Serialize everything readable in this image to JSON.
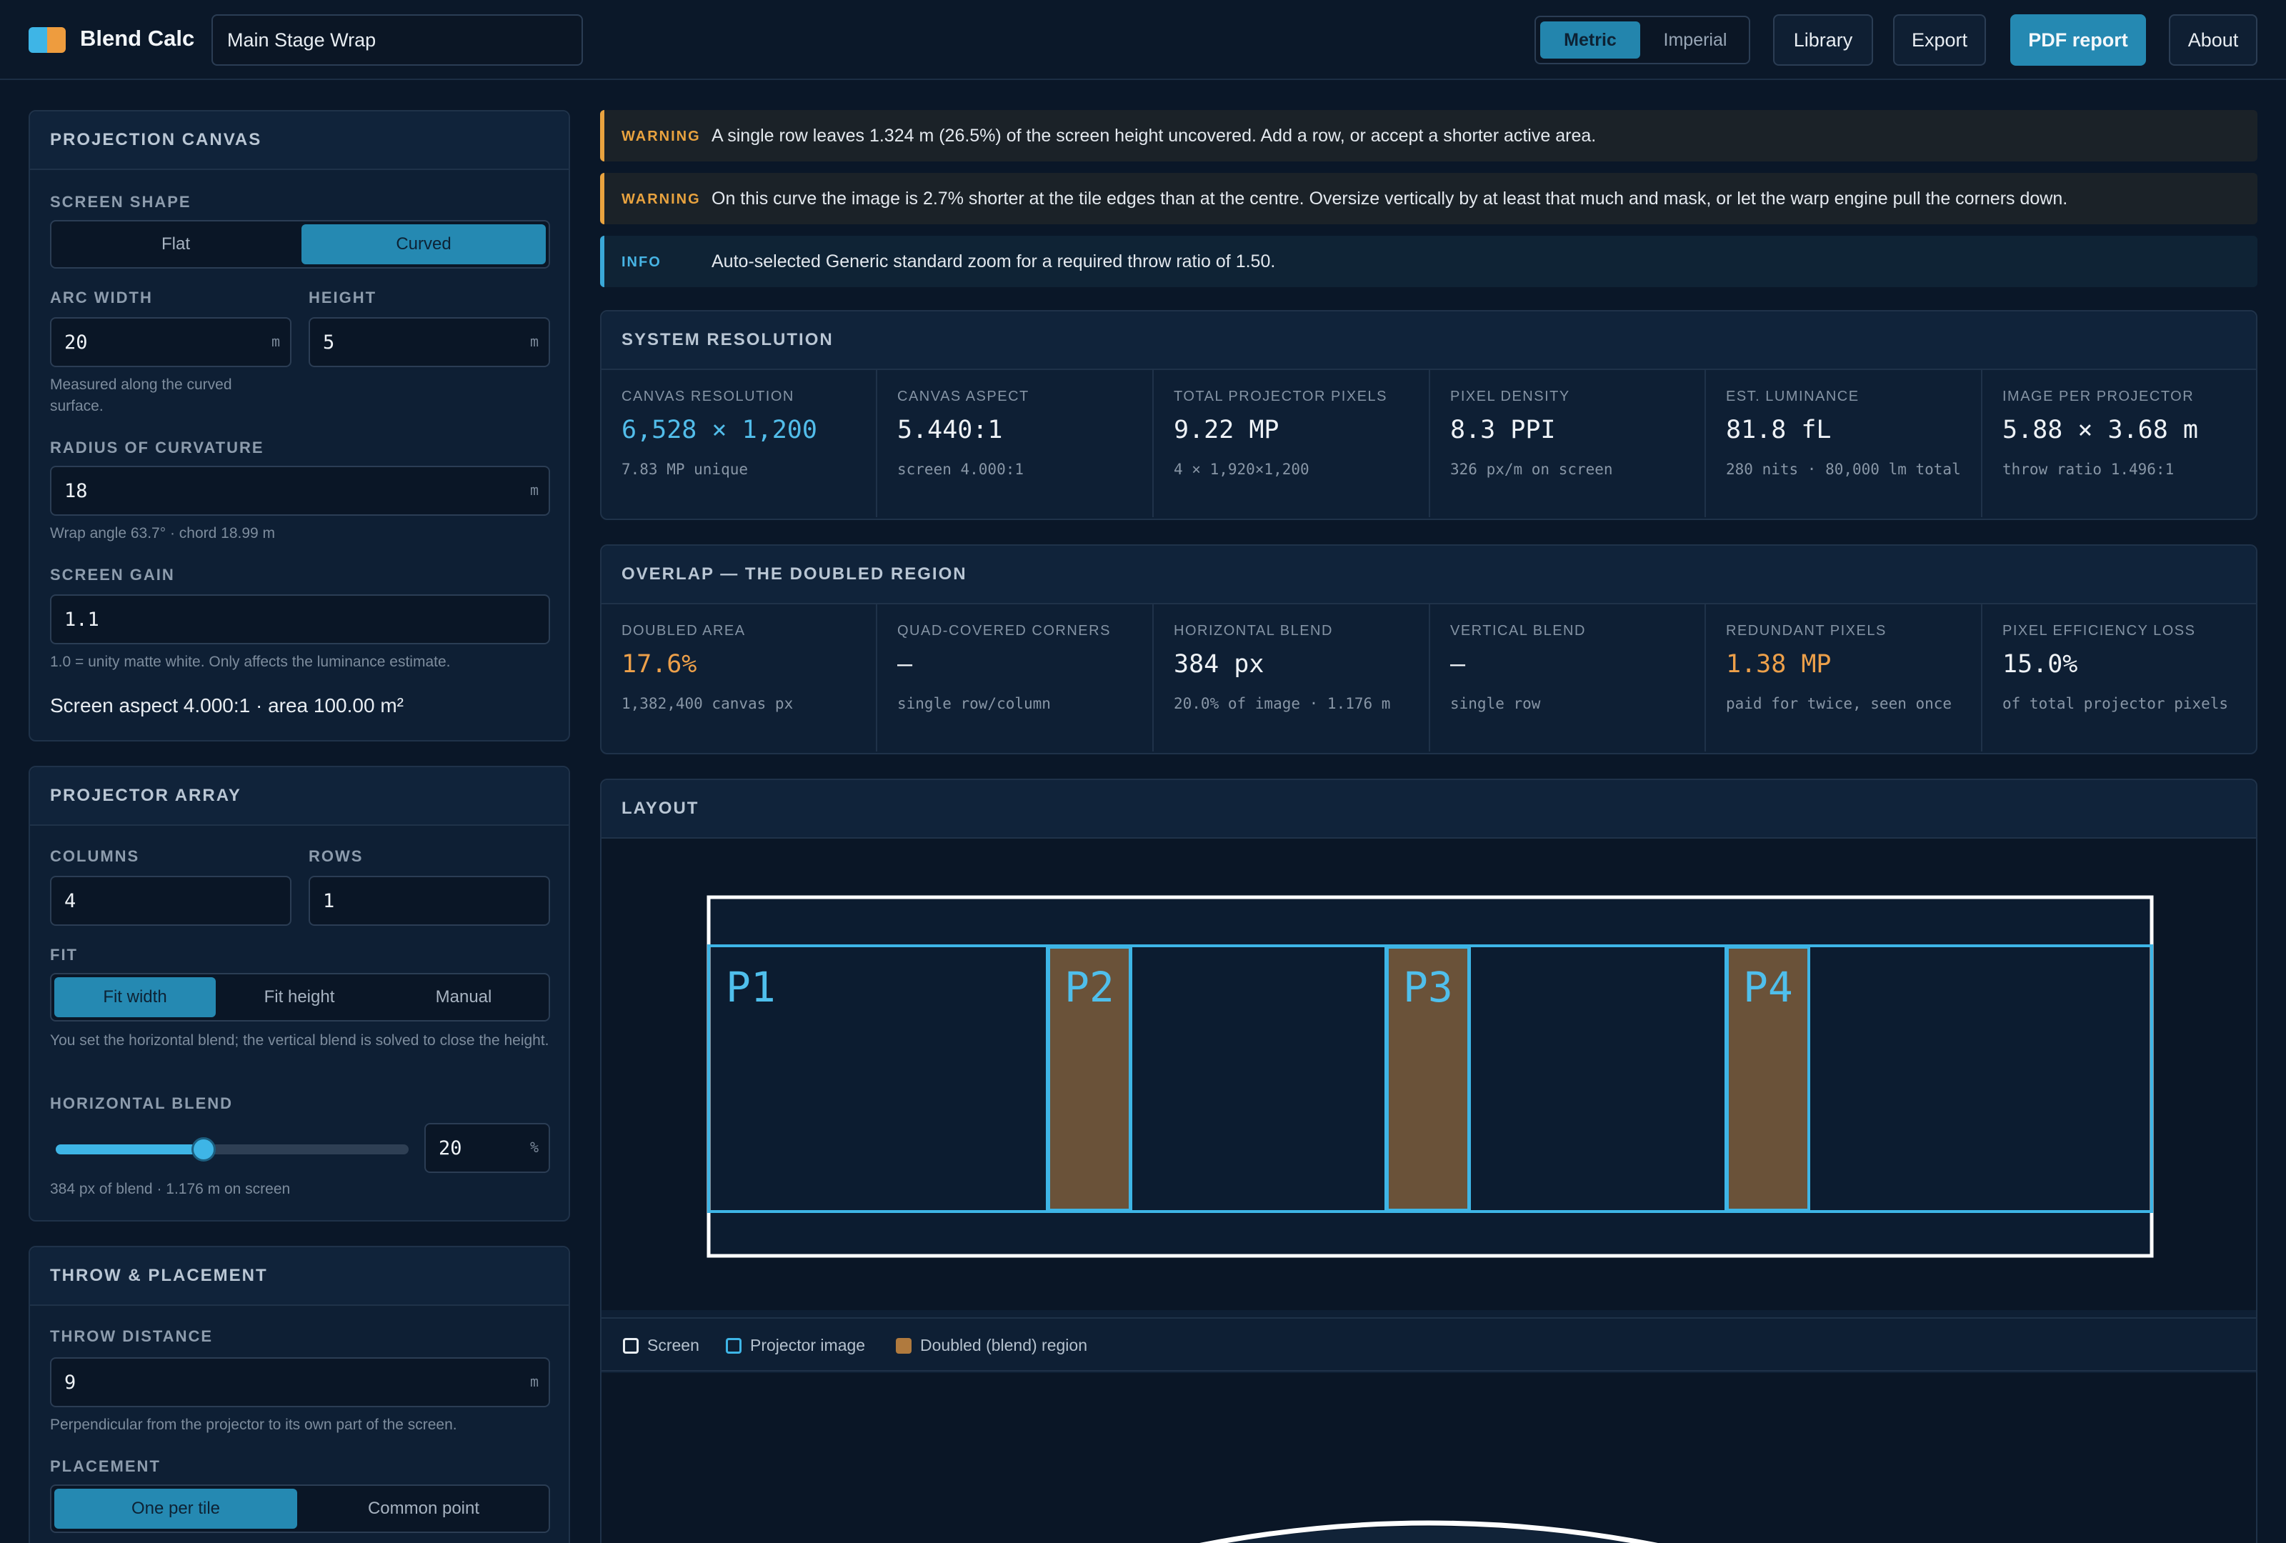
{
  "app": {
    "name": "Blend Calc",
    "project_name": "Main Stage Wrap"
  },
  "units": {
    "metric": "Metric",
    "imperial": "Imperial",
    "selected": "Metric"
  },
  "toolbar": {
    "library": "Library",
    "export": "Export",
    "pdf_report": "PDF report",
    "about": "About"
  },
  "canvas_panel": {
    "title": "PROJECTION CANVAS",
    "screen_shape_label": "SCREEN SHAPE",
    "shape_flat": "Flat",
    "shape_curved": "Curved",
    "arc_width_label": "ARC WIDTH",
    "arc_width_value": "20",
    "arc_width_unit": "m",
    "arc_width_hint": "Measured along the curved surface.",
    "height_label": "HEIGHT",
    "height_value": "5",
    "height_unit": "m",
    "radius_label": "RADIUS OF CURVATURE",
    "radius_value": "18",
    "radius_unit": "m",
    "radius_hint": "Wrap angle 63.7° · chord 18.99 m",
    "gain_label": "SCREEN GAIN",
    "gain_value": "1.1",
    "gain_hint": "1.0 = unity matte white. Only affects the luminance estimate.",
    "aspect_summary": "Screen aspect 4.000:1 · area 100.00 m²"
  },
  "array_panel": {
    "title": "PROJECTOR ARRAY",
    "columns_label": "COLUMNS",
    "columns_value": "4",
    "rows_label": "ROWS",
    "rows_value": "1",
    "fit_label": "FIT",
    "fit_width": "Fit width",
    "fit_height": "Fit height",
    "fit_manual": "Manual",
    "fit_hint": "You set the horizontal blend; the vertical blend is solved to close the height.",
    "hblend_label": "HORIZONTAL BLEND",
    "hblend_value": "20",
    "hblend_unit": "%",
    "hblend_fraction": 0.42,
    "hblend_hint": "384 px of blend · 1.176 m on screen"
  },
  "throw_panel": {
    "title": "THROW & PLACEMENT",
    "throw_label": "THROW DISTANCE",
    "throw_value": "9",
    "throw_unit": "m",
    "throw_hint": "Perpendicular from the projector to its own part of the screen.",
    "placement_label": "PLACEMENT",
    "placement_one": "One per tile",
    "placement_common": "Common point"
  },
  "alerts": [
    {
      "tag": "WARNING",
      "message": "A single row leaves 1.324 m (26.5%) of the screen height uncovered. Add a row, or accept a shorter active area."
    },
    {
      "tag": "WARNING",
      "message": "On this curve the image is 2.7% shorter at the tile edges than at the centre. Oversize vertically by at least that much and mask, or let the warp engine pull the corners down."
    },
    {
      "tag": "INFO",
      "message": "Auto-selected Generic standard zoom for a required throw ratio of 1.50."
    }
  ],
  "system_resolution": {
    "title": "SYSTEM RESOLUTION",
    "stats": [
      {
        "label": "CANVAS RESOLUTION",
        "value": "6,528 × 1,200",
        "sub": "7.83 MP unique"
      },
      {
        "label": "CANVAS ASPECT",
        "value": "5.440:1",
        "sub": "screen 4.000:1"
      },
      {
        "label": "TOTAL PROJECTOR PIXELS",
        "value": "9.22 MP",
        "sub": "4 × 1,920×1,200"
      },
      {
        "label": "PIXEL DENSITY",
        "value": "8.3 PPI",
        "sub": "326 px/m on screen"
      },
      {
        "label": "EST. LUMINANCE",
        "value": "81.8 fL",
        "sub": "280 nits · 80,000 lm total"
      },
      {
        "label": "IMAGE PER PROJECTOR",
        "value": "5.88 × 3.68 m",
        "sub": "throw ratio 1.496:1"
      }
    ]
  },
  "overlap": {
    "title": "OVERLAP — THE DOUBLED REGION",
    "stats": [
      {
        "label": "DOUBLED AREA",
        "value": "17.6%",
        "sub": "1,382,400 canvas px"
      },
      {
        "label": "QUAD-COVERED CORNERS",
        "value": "—",
        "sub": "single row/column"
      },
      {
        "label": "HORIZONTAL BLEND",
        "value": "384 px",
        "sub": "20.0% of image · 1.176 m"
      },
      {
        "label": "VERTICAL BLEND",
        "value": "—",
        "sub": "single row"
      },
      {
        "label": "REDUNDANT PIXELS",
        "value": "1.38 MP",
        "sub": "paid for twice, seen once"
      },
      {
        "label": "PIXEL EFFICIENCY LOSS",
        "value": "15.0%",
        "sub": "of total projector pixels"
      }
    ]
  },
  "layout": {
    "title": "LAYOUT",
    "projectors": [
      "P1",
      "P2",
      "P3",
      "P4"
    ],
    "legend": {
      "screen": "Screen",
      "projector": "Projector image",
      "doubled": "Doubled (blend) region"
    }
  },
  "colors": {
    "accent": "#2589b2",
    "warning": "#e9a33f",
    "info": "#3aa8d8",
    "projector_outline": "#3eb5e6",
    "blend_fill": "#6a5239"
  }
}
